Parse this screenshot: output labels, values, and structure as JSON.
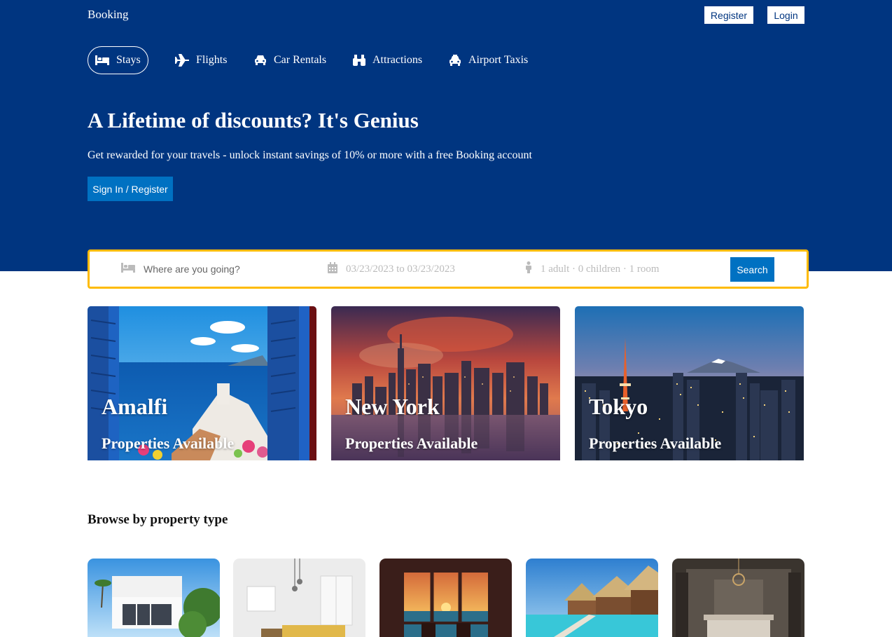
{
  "header": {
    "logo": "Booking",
    "register_label": "Register",
    "login_label": "Login"
  },
  "nav": {
    "items": [
      {
        "label": "Stays",
        "icon": "bed-icon",
        "active": true
      },
      {
        "label": "Flights",
        "icon": "plane-icon",
        "active": false
      },
      {
        "label": "Car Rentals",
        "icon": "car-icon",
        "active": false
      },
      {
        "label": "Attractions",
        "icon": "binoculars-icon",
        "active": false
      },
      {
        "label": "Airport Taxis",
        "icon": "taxi-icon",
        "active": false
      }
    ]
  },
  "hero": {
    "title": "A Lifetime of discounts? It's Genius",
    "subtitle": "Get rewarded for your travels - unlock instant savings of 10% or more with a free Booking account",
    "signin_label": "Sign In / Register"
  },
  "search": {
    "destination_placeholder": "Where are you going?",
    "dates": "03/23/2023 to 03/23/2023",
    "guests": "1 adult · 0 children · 1 room",
    "search_label": "Search"
  },
  "featured": [
    {
      "city": "Amalfi",
      "subtitle": "Properties Available"
    },
    {
      "city": "New York",
      "subtitle": "Properties Available"
    },
    {
      "city": "Tokyo",
      "subtitle": "Properties Available"
    }
  ],
  "browse": {
    "title": "Browse by property type"
  },
  "colors": {
    "header_bg": "#003580",
    "accent_blue": "#0071c2",
    "search_border": "#febb02"
  }
}
